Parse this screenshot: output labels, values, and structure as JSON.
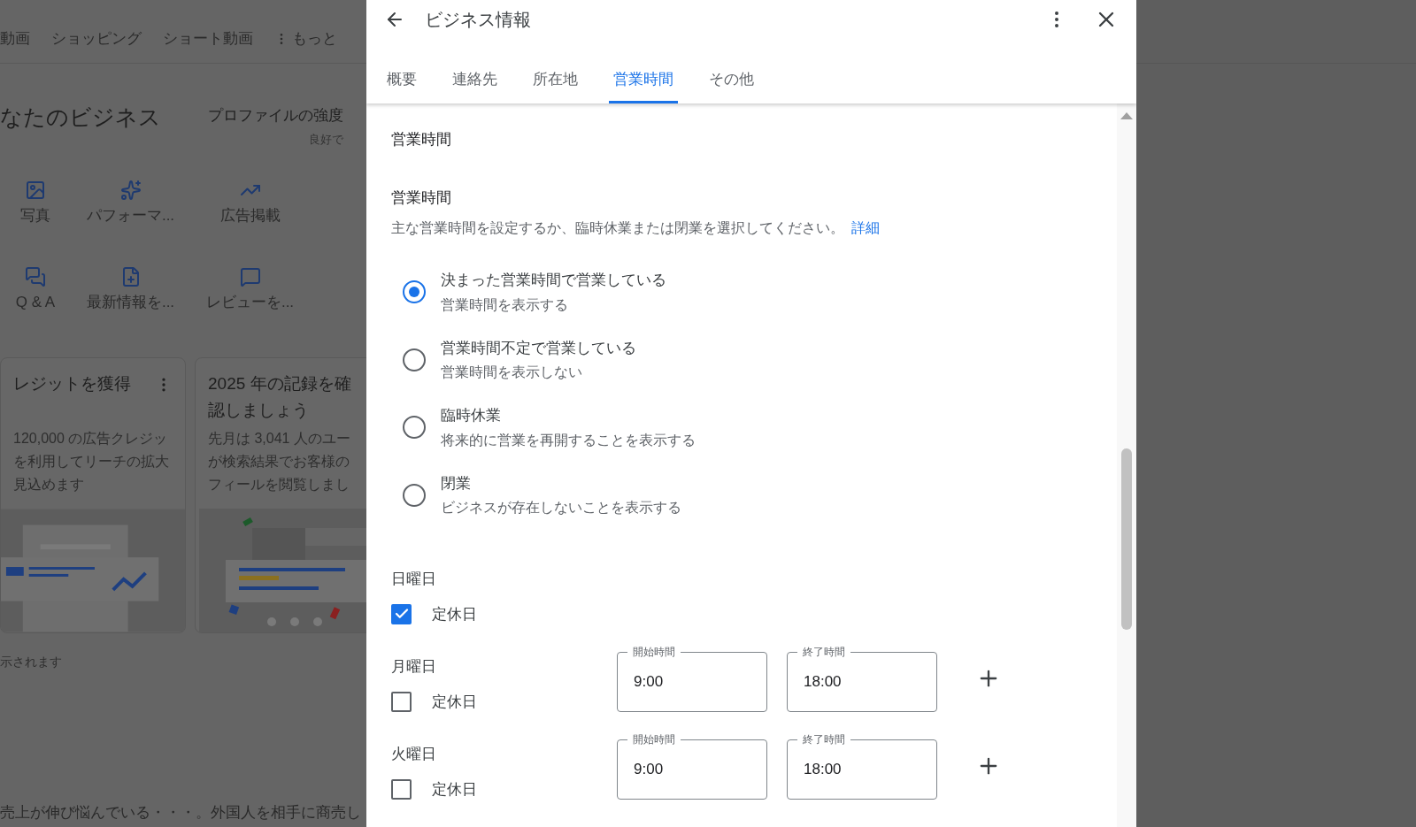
{
  "background": {
    "nav_tabs": [
      "動画",
      "ショッピング",
      "ショート動画"
    ],
    "more_menu": "もっと",
    "heading": "なたのビジネス",
    "profile_strength": {
      "label": "プロファイルの強度",
      "status": "良好で"
    },
    "actions": [
      {
        "label": "写真",
        "kind": "photo"
      },
      {
        "label": "パフォーマ...",
        "kind": "performance"
      },
      {
        "label": "広告掲載",
        "kind": "ads"
      },
      {
        "label": "Q & A",
        "kind": "qa"
      },
      {
        "label": "最新情報を...",
        "kind": "post"
      },
      {
        "label": "レビューを...",
        "kind": "review"
      }
    ],
    "cards": [
      {
        "title_lines": [
          "レジットを獲得"
        ],
        "body_lines": [
          "120,000 の広告クレジッ",
          "を利用してリーチの拡大",
          "見込めます"
        ],
        "has_menu": true,
        "kind": "ads"
      },
      {
        "title_lines": [
          "2025 年の記録を確",
          "認しましょう"
        ],
        "body_lines": [
          "先月は 3,041 人のユー",
          "が検索結果でお客様の",
          "フィールを閲覧しまし"
        ],
        "has_menu": false,
        "kind": "reviews"
      }
    ],
    "note": "示されます",
    "footer_text": "売上が伸び悩んでいる・・・。外国人を相手に商売し"
  },
  "dialog": {
    "title": "ビジネス情報",
    "tabs": [
      {
        "label": "概要",
        "selected": false
      },
      {
        "label": "連絡先",
        "selected": false
      },
      {
        "label": "所在地",
        "selected": false
      },
      {
        "label": "営業時間",
        "selected": true
      },
      {
        "label": "その他",
        "selected": false
      }
    ],
    "section_title": "営業時間",
    "field_label": "営業時間",
    "description": "主な営業時間を設定するか、臨時休業または閉業を選択してください。",
    "learn_more": "詳細",
    "options": [
      {
        "title": "決まった営業時間で営業している",
        "subtitle": "営業時間を表示する",
        "selected": true
      },
      {
        "title": "営業時間不定で営業している",
        "subtitle": "営業時間を表示しない",
        "selected": false
      },
      {
        "title": "臨時休業",
        "subtitle": "将来的に営業を再開することを表示する",
        "selected": false
      },
      {
        "title": "閉業",
        "subtitle": "ビジネスが存在しないことを表示する",
        "selected": false
      }
    ],
    "days": [
      {
        "name": "日曜日",
        "closed_label": "定休日",
        "closed": true
      },
      {
        "name": "月曜日",
        "closed_label": "定休日",
        "closed": false,
        "open_label": "開始時間",
        "open": "9:00",
        "close_label": "終了時間",
        "close": "18:00"
      },
      {
        "name": "火曜日",
        "closed_label": "定休日",
        "closed": false,
        "open_label": "開始時間",
        "open": "9:00",
        "close_label": "終了時間",
        "close": "18:00"
      }
    ]
  }
}
